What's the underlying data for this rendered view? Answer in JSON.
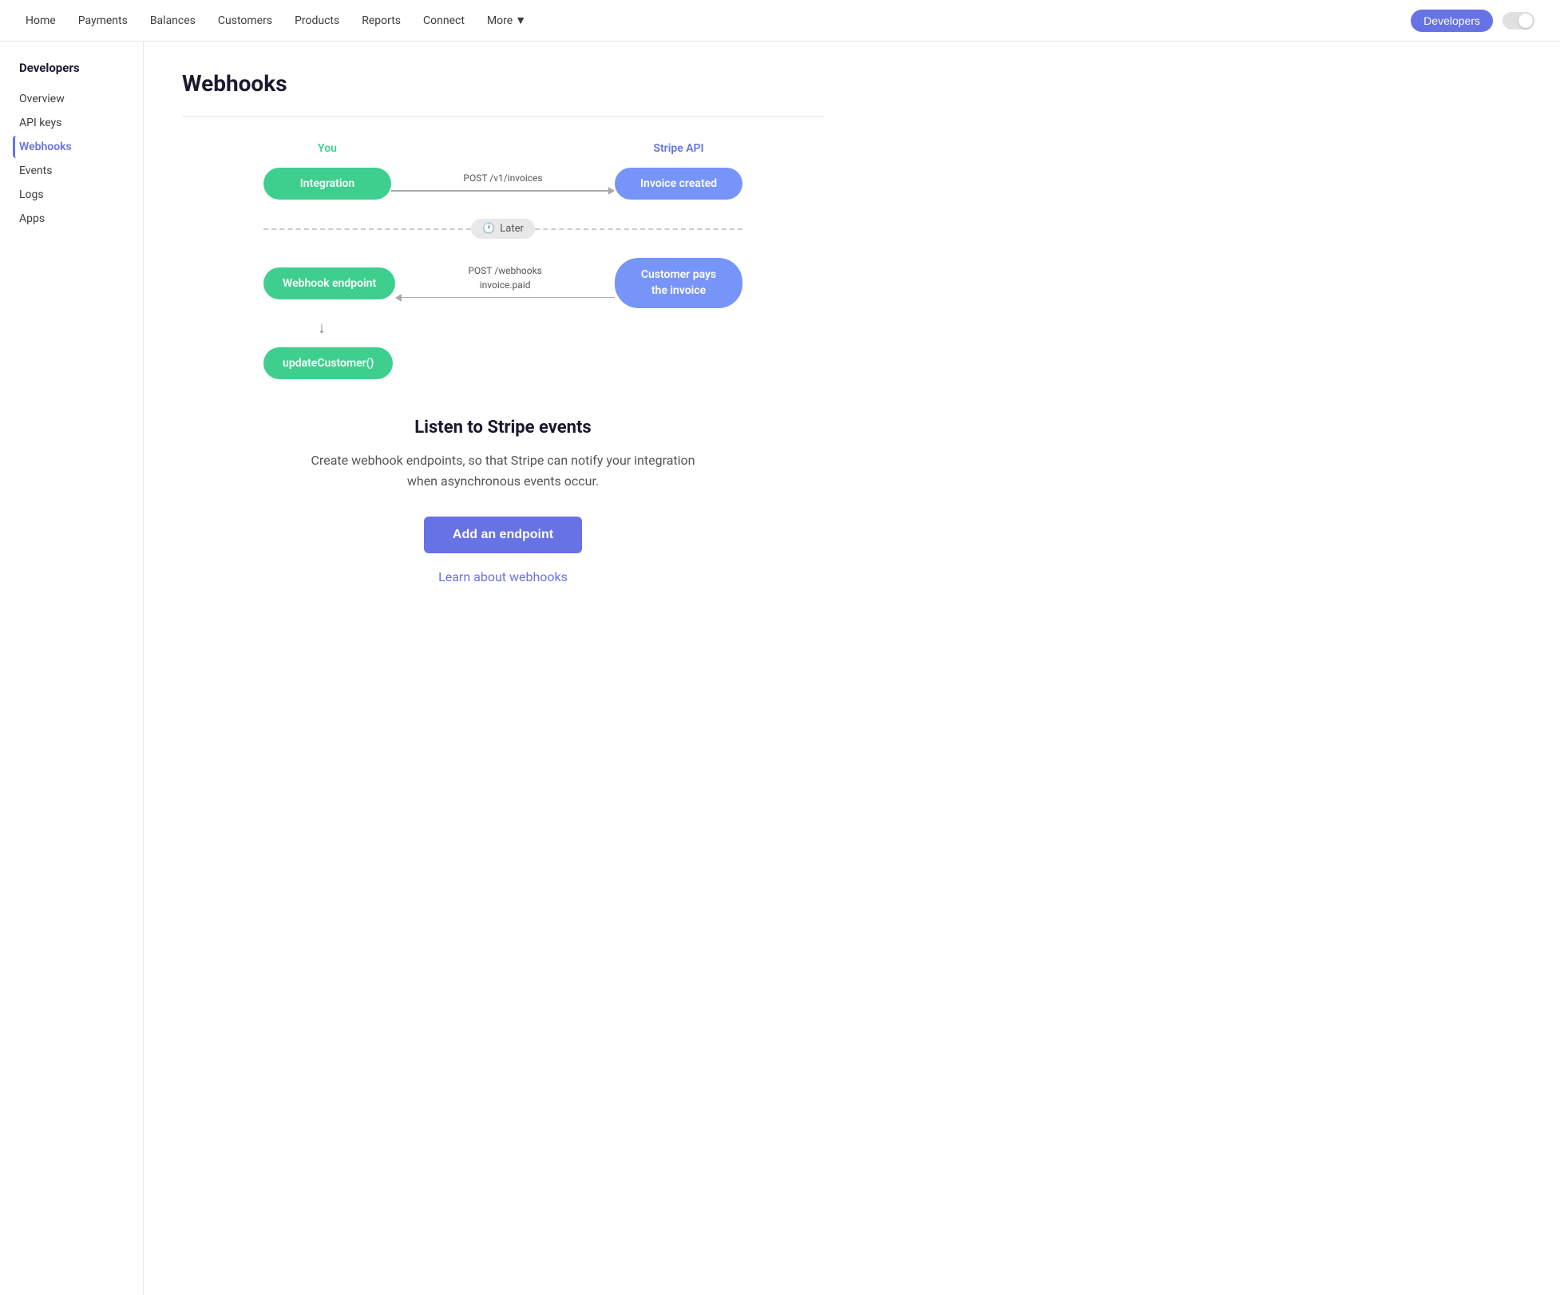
{
  "nav": {
    "items": [
      {
        "label": "Home",
        "id": "home"
      },
      {
        "label": "Payments",
        "id": "payments"
      },
      {
        "label": "Balances",
        "id": "balances"
      },
      {
        "label": "Customers",
        "id": "customers"
      },
      {
        "label": "Products",
        "id": "products"
      },
      {
        "label": "Reports",
        "id": "reports"
      },
      {
        "label": "Connect",
        "id": "connect"
      },
      {
        "label": "More",
        "id": "more",
        "hasChevron": true
      }
    ],
    "developers_button": "Developers"
  },
  "sidebar": {
    "title": "Developers",
    "items": [
      {
        "label": "Overview",
        "id": "overview",
        "active": false
      },
      {
        "label": "API keys",
        "id": "api-keys",
        "active": false
      },
      {
        "label": "Webhooks",
        "id": "webhooks",
        "active": true
      },
      {
        "label": "Events",
        "id": "events",
        "active": false
      },
      {
        "label": "Logs",
        "id": "logs",
        "active": false
      },
      {
        "label": "Apps",
        "id": "apps",
        "active": false
      }
    ]
  },
  "main": {
    "title": "Webhooks",
    "diagram": {
      "label_you": "You",
      "label_stripe": "Stripe API",
      "integration_pill": "Integration",
      "invoice_created_pill": "Invoice created",
      "arrow1_label": "POST /v1/invoices",
      "later_label": "Later",
      "webhook_endpoint_pill": "Webhook endpoint",
      "customer_pays_pill": "Customer pays\nthe invoice",
      "arrow2_label1": "POST /webhooks",
      "arrow2_label2": "invoice.paid",
      "update_customer_pill": "updateCustomer()"
    },
    "listen_section": {
      "title": "Listen to Stripe events",
      "description": "Create webhook endpoints, so that Stripe can notify your integration when asynchronous events occur.",
      "add_endpoint_button": "Add an endpoint",
      "learn_link": "Learn about webhooks"
    }
  }
}
